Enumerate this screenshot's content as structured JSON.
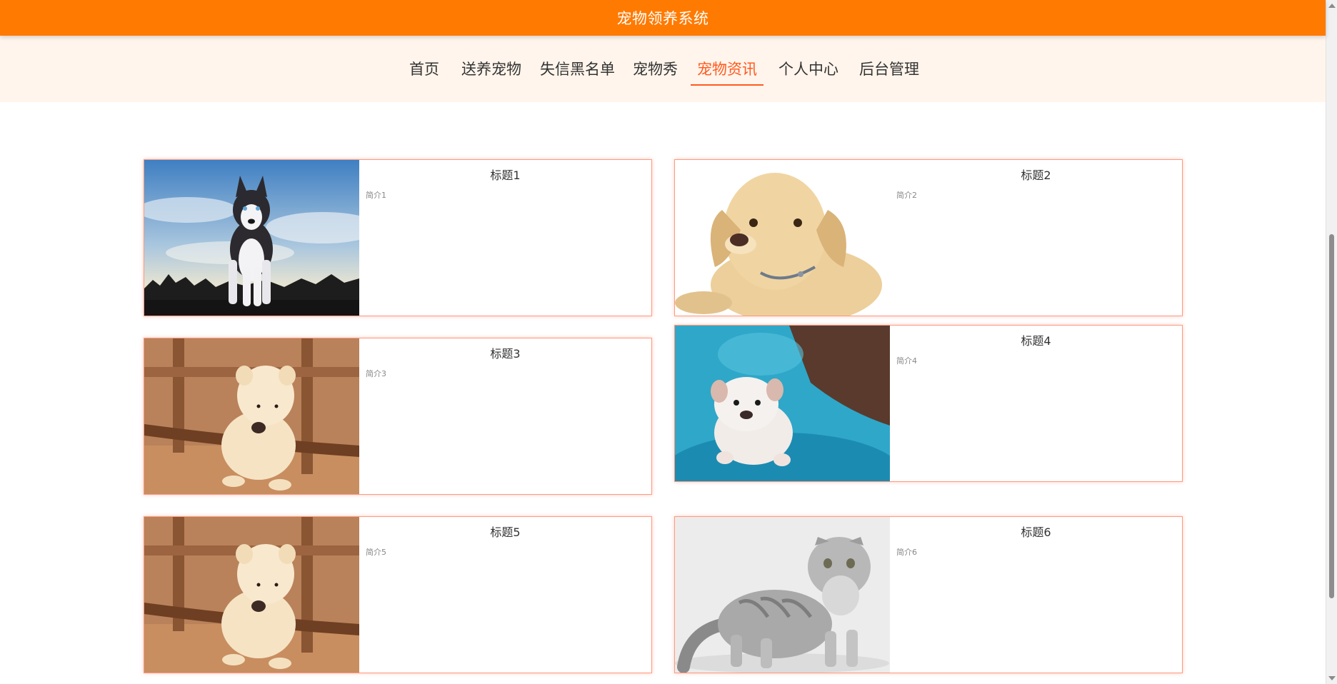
{
  "header": {
    "title": "宠物领养系统",
    "color": "#ff7a00"
  },
  "nav": {
    "active_color": "#ff5a1f",
    "items": [
      {
        "label": "首页"
      },
      {
        "label": "送养宠物"
      },
      {
        "label": "失信黑名单"
      },
      {
        "label": "宠物秀"
      },
      {
        "label": "宠物资讯",
        "active": true
      },
      {
        "label": "个人中心"
      },
      {
        "label": "后台管理"
      }
    ]
  },
  "news": {
    "items": [
      {
        "title": "标题1",
        "intro": "简介1",
        "image": "husky-dog-photo"
      },
      {
        "title": "标题2",
        "intro": "简介2",
        "image": "labrador-puppy-photo"
      },
      {
        "title": "标题3",
        "intro": "简介3",
        "image": "fluffy-puppy-on-chair-photo"
      },
      {
        "title": "标题4",
        "intro": "简介4",
        "image": "bulldog-puppy-in-blue-tub-photo"
      },
      {
        "title": "标题5",
        "intro": "简介5",
        "image": "fluffy-puppy-on-chair-photo"
      },
      {
        "title": "标题6",
        "intro": "简介6",
        "image": "tabby-fold-cat-photo"
      }
    ]
  }
}
